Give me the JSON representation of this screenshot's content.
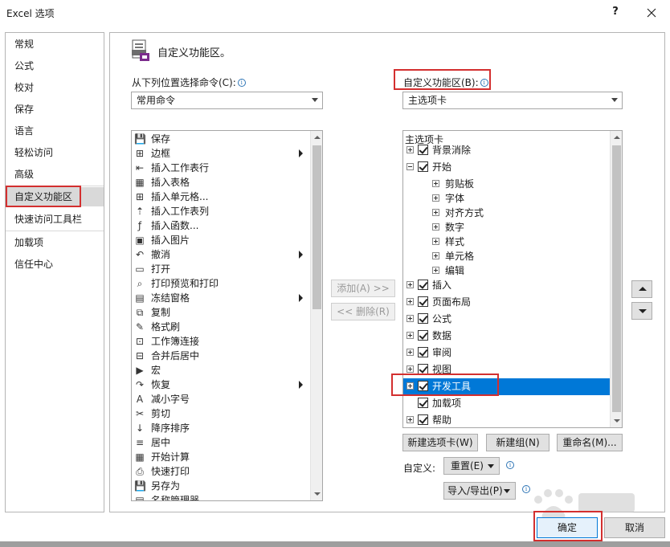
{
  "window": {
    "title": "Excel 选项",
    "help": "?",
    "close_icon": "close-icon"
  },
  "sidebar": {
    "items": [
      {
        "label": "常规"
      },
      {
        "label": "公式"
      },
      {
        "label": "校对"
      },
      {
        "label": "保存"
      },
      {
        "label": "语言"
      },
      {
        "label": "轻松访问"
      },
      {
        "label": "高级"
      },
      {
        "label": "自定义功能区",
        "selected": true
      },
      {
        "label": "快速访问工具栏"
      },
      {
        "label": "加载项"
      },
      {
        "label": "信任中心"
      }
    ]
  },
  "header": {
    "title": "自定义功能区。",
    "icon": "customize-ribbon-icon"
  },
  "commands": {
    "from_label": "从下列位置选择命令(C):",
    "from_value": "常用命令",
    "items": [
      {
        "label": "保存",
        "icon": "save-icon",
        "glyph": "💾"
      },
      {
        "label": "边框",
        "icon": "border-icon",
        "glyph": "⊞",
        "submenu": true
      },
      {
        "label": "插入工作表行",
        "icon": "insert-row-icon",
        "glyph": "⇤"
      },
      {
        "label": "插入表格",
        "icon": "table-icon",
        "glyph": "▦"
      },
      {
        "label": "插入单元格...",
        "icon": "insert-cells-icon",
        "glyph": "⊞"
      },
      {
        "label": "插入工作表列",
        "icon": "insert-column-icon",
        "glyph": "⇡"
      },
      {
        "label": "插入函数...",
        "icon": "function-icon",
        "glyph": "ƒ"
      },
      {
        "label": "插入图片",
        "icon": "picture-icon",
        "glyph": "▣"
      },
      {
        "label": "撤消",
        "icon": "undo-icon",
        "glyph": "↶",
        "submenu": true
      },
      {
        "label": "打开",
        "icon": "open-folder-icon",
        "glyph": "▭"
      },
      {
        "label": "打印预览和打印",
        "icon": "print-preview-icon",
        "glyph": "⌕"
      },
      {
        "label": "冻结窗格",
        "icon": "freeze-panes-icon",
        "glyph": "▤",
        "submenu": true
      },
      {
        "label": "复制",
        "icon": "copy-icon",
        "glyph": "⧉"
      },
      {
        "label": "格式刷",
        "icon": "format-painter-icon",
        "glyph": "✎"
      },
      {
        "label": "工作簿连接",
        "icon": "workbook-connections-icon",
        "glyph": "⊡"
      },
      {
        "label": "合并后居中",
        "icon": "merge-center-icon",
        "glyph": "⊟"
      },
      {
        "label": "宏",
        "icon": "macro-icon",
        "glyph": "▶"
      },
      {
        "label": "恢复",
        "icon": "redo-icon",
        "glyph": "↷",
        "submenu": true
      },
      {
        "label": "减小字号",
        "icon": "decrease-font-icon",
        "glyph": "A"
      },
      {
        "label": "剪切",
        "icon": "cut-icon",
        "glyph": "✂"
      },
      {
        "label": "降序排序",
        "icon": "sort-descending-icon",
        "glyph": "↓"
      },
      {
        "label": "居中",
        "icon": "center-align-icon",
        "glyph": "≡"
      },
      {
        "label": "开始计算",
        "icon": "calculate-icon",
        "glyph": "▦"
      },
      {
        "label": "快速打印",
        "icon": "quick-print-icon",
        "glyph": "⎙"
      },
      {
        "label": "另存为",
        "icon": "save-as-icon",
        "glyph": "💾"
      },
      {
        "label": "名称管理器",
        "icon": "name-manager-icon",
        "glyph": "▤"
      }
    ]
  },
  "middle": {
    "add_label": "添加(A) >>",
    "remove_label": "<< 删除(R)"
  },
  "ribbon": {
    "label": "自定义功能区(B):",
    "value": "主选项卡",
    "tree_header": "主选项卡",
    "items": [
      {
        "label": "背景消除",
        "expander": "plus",
        "check": true,
        "level": 0
      },
      {
        "label": "开始",
        "expander": "minus",
        "check": true,
        "level": 0
      },
      {
        "label": "剪贴板",
        "expander": "plus",
        "check": false,
        "level": 1
      },
      {
        "label": "字体",
        "expander": "plus",
        "check": false,
        "level": 1
      },
      {
        "label": "对齐方式",
        "expander": "plus",
        "check": false,
        "level": 1
      },
      {
        "label": "数字",
        "expander": "plus",
        "check": false,
        "level": 1
      },
      {
        "label": "样式",
        "expander": "plus",
        "check": false,
        "level": 1
      },
      {
        "label": "单元格",
        "expander": "plus",
        "check": false,
        "level": 1
      },
      {
        "label": "编辑",
        "expander": "plus",
        "check": false,
        "level": 1
      },
      {
        "label": "插入",
        "expander": "plus",
        "check": true,
        "level": 0
      },
      {
        "label": "页面布局",
        "expander": "plus",
        "check": true,
        "level": 0
      },
      {
        "label": "公式",
        "expander": "plus",
        "check": true,
        "level": 0
      },
      {
        "label": "数据",
        "expander": "plus",
        "check": true,
        "level": 0
      },
      {
        "label": "审阅",
        "expander": "plus",
        "check": true,
        "level": 0
      },
      {
        "label": "视图",
        "expander": "plus",
        "check": true,
        "level": 0
      },
      {
        "label": "开发工具",
        "expander": "plus",
        "check": true,
        "level": 0,
        "selected": true
      },
      {
        "label": "加载项",
        "expander": "none",
        "check": true,
        "level": 0
      },
      {
        "label": "帮助",
        "expander": "plus",
        "check": true,
        "level": 0
      }
    ],
    "new_tab": "新建选项卡(W)",
    "new_group": "新建组(N)",
    "rename": "重命名(M)...",
    "customize_label": "自定义:",
    "reset": "重置(E)",
    "import_export": "导入/导出(P)"
  },
  "footer": {
    "ok": "确定",
    "cancel": "取消"
  },
  "colors": {
    "accent": "#0078d7",
    "highlight_box": "#d32f2f",
    "info": "#2e75b6"
  }
}
